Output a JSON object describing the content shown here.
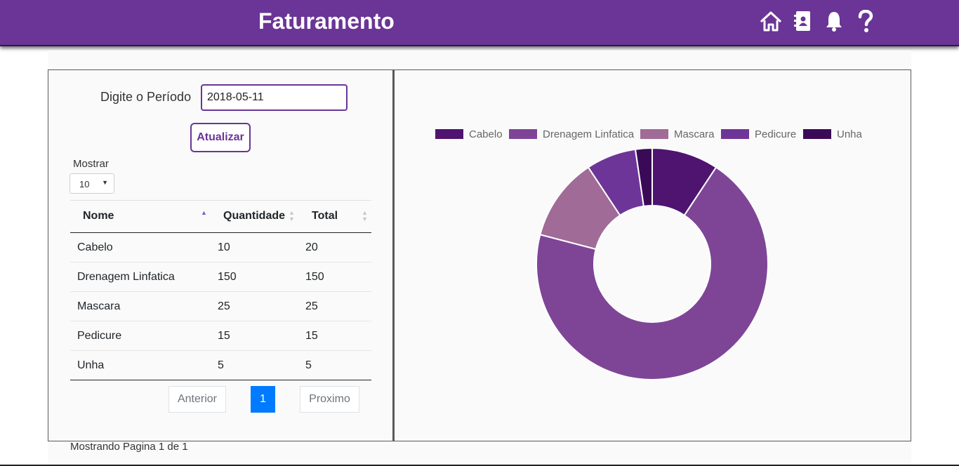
{
  "header": {
    "title": "Faturamento",
    "icons": [
      "home-icon",
      "address-book-icon",
      "bell-icon",
      "help-icon"
    ]
  },
  "form": {
    "period_label": "Digite o Período",
    "period_value": "2018-05-11",
    "update_button": "Atualizar"
  },
  "table_controls": {
    "show_label": "Mostrar",
    "show_value": "10"
  },
  "table": {
    "columns": [
      "Nome",
      "Quantidade",
      "Total"
    ],
    "rows": [
      [
        "Cabelo",
        "10",
        "20"
      ],
      [
        "Drenagem Linfatica",
        "150",
        "150"
      ],
      [
        "Mascara",
        "25",
        "25"
      ],
      [
        "Pedicure",
        "15",
        "15"
      ],
      [
        "Unha",
        "5",
        "5"
      ]
    ]
  },
  "pagination": {
    "previous": "Anterior",
    "current": "1",
    "next": "Proximo",
    "info": "Mostrando Pagina 1 de 1"
  },
  "colors": {
    "brand": "#6a3596",
    "accent_blue": "#007bff"
  },
  "chart_data": {
    "type": "pie",
    "variant": "doughnut",
    "categories": [
      "Cabelo",
      "Drenagem Linfatica",
      "Mascara",
      "Pedicure",
      "Unha"
    ],
    "values": [
      20,
      150,
      25,
      15,
      5
    ],
    "colors": [
      "#4e1470",
      "#7e4597",
      "#a06b96",
      "#6e3598",
      "#3a0a57"
    ],
    "legend_position": "top"
  }
}
